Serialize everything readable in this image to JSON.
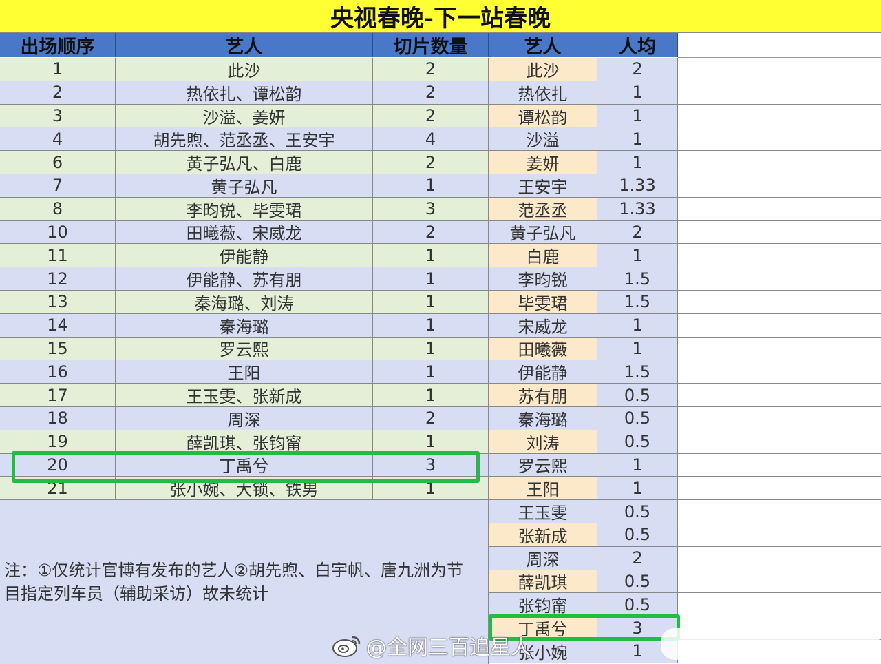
{
  "title": "央视春晚-下一站春晚",
  "headers": [
    "出场顺序",
    "艺人",
    "切片数量",
    "艺人",
    "人均"
  ],
  "colors": {
    "title_bg": "#ffff33",
    "header_bg": "#4a78c8",
    "row_green": "#e4efd8",
    "row_blue": "#d7def3",
    "right_name_orange": "#fce9c9",
    "highlight_green": "#22bb44"
  },
  "left_rows": [
    {
      "order": "1",
      "artist": "此沙",
      "count": "2"
    },
    {
      "order": "2",
      "artist": "热依扎、谭松韵",
      "count": "2"
    },
    {
      "order": "3",
      "artist": "沙溢、姜妍",
      "count": "2"
    },
    {
      "order": "4",
      "artist": "胡先煦、范丞丞、王安宇",
      "count": "4"
    },
    {
      "order": "6",
      "artist": "黄子弘凡、白鹿",
      "count": "2"
    },
    {
      "order": "7",
      "artist": "黄子弘凡",
      "count": "1"
    },
    {
      "order": "8",
      "artist": "李昀锐、毕雯珺",
      "count": "3"
    },
    {
      "order": "10",
      "artist": "田曦薇、宋威龙",
      "count": "2"
    },
    {
      "order": "11",
      "artist": "伊能静",
      "count": "1"
    },
    {
      "order": "12",
      "artist": "伊能静、苏有朋",
      "count": "1"
    },
    {
      "order": "13",
      "artist": "秦海璐、刘涛",
      "count": "1"
    },
    {
      "order": "14",
      "artist": "秦海璐",
      "count": "1"
    },
    {
      "order": "15",
      "artist": "罗云熙",
      "count": "1"
    },
    {
      "order": "16",
      "artist": "王阳",
      "count": "1"
    },
    {
      "order": "17",
      "artist": "王玉雯、张新成",
      "count": "1"
    },
    {
      "order": "18",
      "artist": "周深",
      "count": "2"
    },
    {
      "order": "19",
      "artist": "薛凯琪、张钧甯",
      "count": "1"
    },
    {
      "order": "20",
      "artist": "丁禹兮",
      "count": "3"
    },
    {
      "order": "21",
      "artist": "张小婉、大锁、铁男",
      "count": "1"
    }
  ],
  "right_rows": [
    {
      "artist": "此沙",
      "avg": "2"
    },
    {
      "artist": "热依扎",
      "avg": "1"
    },
    {
      "artist": "谭松韵",
      "avg": "1"
    },
    {
      "artist": "沙溢",
      "avg": "1"
    },
    {
      "artist": "姜妍",
      "avg": "1"
    },
    {
      "artist": "王安宇",
      "avg": "1.33"
    },
    {
      "artist": "范丞丞",
      "avg": "1.33"
    },
    {
      "artist": "黄子弘凡",
      "avg": "2"
    },
    {
      "artist": "白鹿",
      "avg": "1"
    },
    {
      "artist": "李昀锐",
      "avg": "1.5"
    },
    {
      "artist": "毕雯珺",
      "avg": "1.5"
    },
    {
      "artist": "宋威龙",
      "avg": "1"
    },
    {
      "artist": "田曦薇",
      "avg": "1"
    },
    {
      "artist": "伊能静",
      "avg": "1.5"
    },
    {
      "artist": "苏有朋",
      "avg": "0.5"
    },
    {
      "artist": "秦海璐",
      "avg": "0.5"
    },
    {
      "artist": "刘涛",
      "avg": "0.5"
    },
    {
      "artist": "罗云熙",
      "avg": "1"
    },
    {
      "artist": "王阳",
      "avg": "1"
    },
    {
      "artist": "王玉雯",
      "avg": "0.5"
    },
    {
      "artist": "张新成",
      "avg": "0.5"
    },
    {
      "artist": "周深",
      "avg": "2"
    },
    {
      "artist": "薛凯琪",
      "avg": "0.5"
    },
    {
      "artist": "张钧甯",
      "avg": "0.5"
    },
    {
      "artist": "丁禹兮",
      "avg": "3"
    },
    {
      "artist": "张小婉",
      "avg": "1"
    }
  ],
  "note_line1": "注：①仅统计官博有发布的艺人②胡先煦、白宇帆、唐九洲为节",
  "note_line2": "目指定列车员（辅助采访）故未统计",
  "watermark": "@全网三百追星人",
  "watermark_icon": "weibo-icon",
  "highlighted_left_order": "20",
  "highlighted_right_artist": "丁禹兮"
}
